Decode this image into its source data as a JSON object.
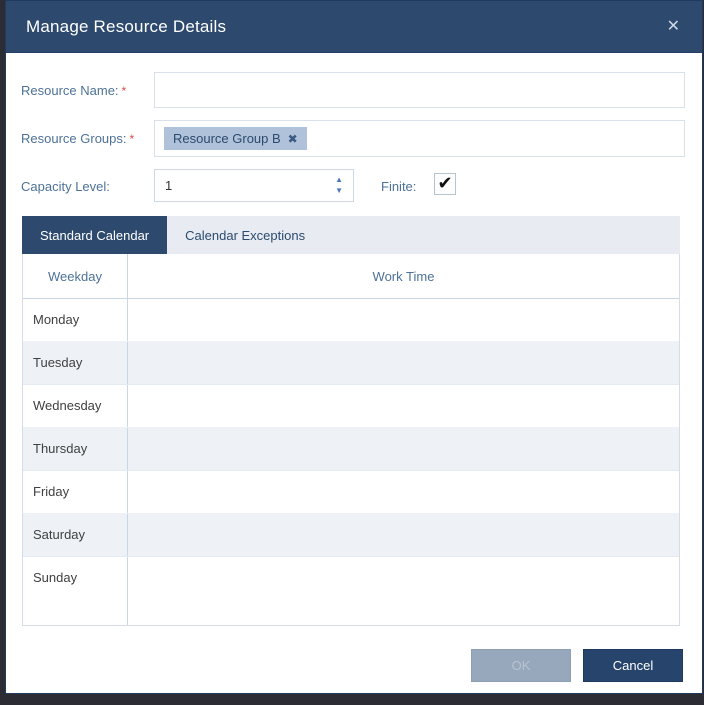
{
  "dialog": {
    "title": "Manage Resource Details"
  },
  "icons": {
    "close": "✕",
    "tag_remove": "✖",
    "check": "✔",
    "spin_up": "▲",
    "spin_down": "▼"
  },
  "form": {
    "resource_name": {
      "label": "Resource Name:",
      "required_marker": "*",
      "value": "",
      "placeholder": ""
    },
    "resource_groups": {
      "label": "Resource Groups:",
      "required_marker": "*",
      "tags": [
        {
          "label": "Resource Group B"
        }
      ]
    },
    "capacity_level": {
      "label": "Capacity Level:",
      "value": "1"
    },
    "finite": {
      "label": "Finite:",
      "checked": true
    }
  },
  "tabs": [
    {
      "label": "Standard Calendar",
      "active": true
    },
    {
      "label": "Calendar Exceptions",
      "active": false
    }
  ],
  "calendar_table": {
    "columns": [
      "Weekday",
      "Work Time"
    ],
    "rows": [
      {
        "weekday": "Monday",
        "work_time": ""
      },
      {
        "weekday": "Tuesday",
        "work_time": ""
      },
      {
        "weekday": "Wednesday",
        "work_time": ""
      },
      {
        "weekday": "Thursday",
        "work_time": ""
      },
      {
        "weekday": "Friday",
        "work_time": ""
      },
      {
        "weekday": "Saturday",
        "work_time": ""
      },
      {
        "weekday": "Sunday",
        "work_time": ""
      }
    ]
  },
  "footer": {
    "ok_label": "OK",
    "cancel_label": "Cancel"
  },
  "colors": {
    "header_bg": "#2d4a6e",
    "active_tab_bg": "#2d4a6e",
    "cancel_bg": "#26446c",
    "disabled_ok_bg": "#98a8bc",
    "tag_bg": "#b0c2d9",
    "label_text": "#4d7299",
    "required_marker": "#e14b4b",
    "alt_row_bg": "#eef2f7",
    "page_backdrop": "#2c2c34"
  }
}
